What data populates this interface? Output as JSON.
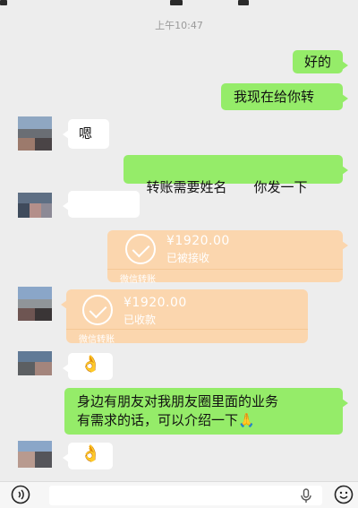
{
  "status": {
    "time": "上午10:47"
  },
  "messages": {
    "m1": "好的",
    "m2": "我现在给你转",
    "m3": "嗯",
    "m4": "转账需要姓名　　你发一下",
    "m7_line1": "身边有朋友对我朋友圈里面的业务",
    "m7_line2": "有需求的话，可以介绍一下"
  },
  "transfers": {
    "t1": {
      "amount": "¥1920.00",
      "status": "已被接收",
      "footer": "微信转账"
    },
    "t2": {
      "amount": "¥1920.00",
      "status": "已收款",
      "footer": "微信转账"
    }
  },
  "emojis": {
    "ok_hand": "👌",
    "pray": "🙏"
  },
  "colors": {
    "sent_bubble": "#95ec69",
    "received_bubble": "#ffffff",
    "transfer_card": "#fbd6ae",
    "background": "#ededed"
  },
  "icons": [
    "voice-input-icon",
    "microphone-icon",
    "emoji-icon",
    "check-circle-icon"
  ]
}
